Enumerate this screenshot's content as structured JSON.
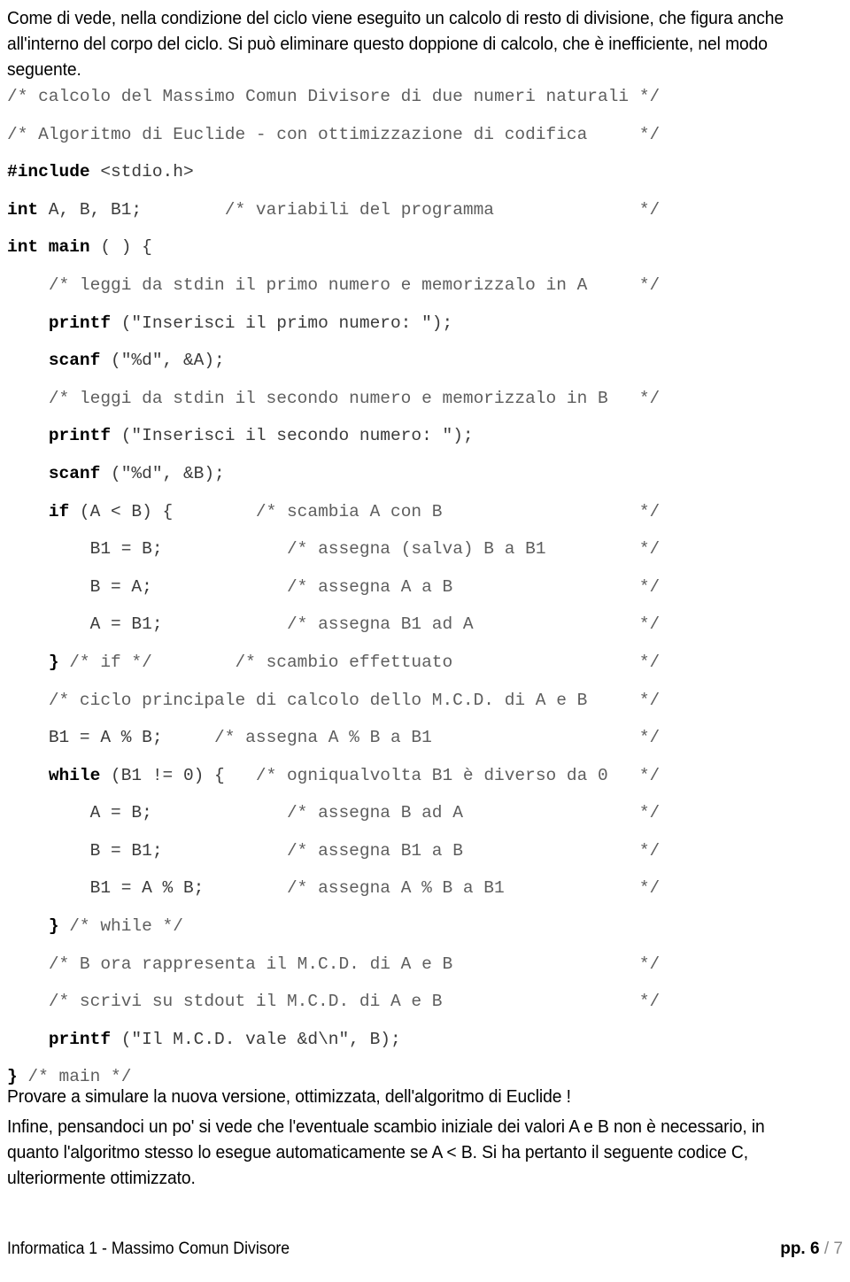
{
  "document": {
    "title": "Informatica 1 - Massimo Comun Divisore",
    "intro_paragraph": "Come di vede, nella condizione del ciclo viene eseguito un calcolo di resto di divisione, che figura anche all'interno del corpo del ciclo. Si può eliminare questo doppione di calcolo, che è inefficiente, nel modo seguente.",
    "closing_note": "Provare a simulare la nuova versione, ottimizzata, dell'algoritmo di Euclide !",
    "final_paragraph": "Infine, pensandoci un po' si vede che l'eventuale scambio iniziale dei valori A e B non è necessario, in quanto l'algoritmo stesso lo esegue automaticamente se A < B. Si ha pertanto il seguente codice C, ulteriormente ottimizzato."
  },
  "code": {
    "language": "C",
    "lines": [
      {
        "indent": 0,
        "segments": [
          {
            "t": "/* calcolo del Massimo Comun Divisore di due numeri naturali",
            "s": "cm"
          }
        ],
        "comment_end": "*/"
      },
      {
        "indent": 0,
        "segments": [
          {
            "t": "/* Algoritmo di Euclide - con ottimizzazione di codifica",
            "s": "cm"
          }
        ],
        "comment_end": "*/"
      },
      {
        "indent": 0,
        "segments": [
          {
            "t": "#include",
            "s": "kw"
          },
          {
            "t": " <stdio.h>",
            "s": "lit"
          }
        ],
        "comment_end": ""
      },
      {
        "indent": 0,
        "segments": [
          {
            "t": "int",
            "s": "kw"
          },
          {
            "t": " A, B, B1;",
            "s": "lit"
          },
          {
            "t": "        /* variabili del programma",
            "s": "cm"
          }
        ],
        "comment_end": "*/"
      },
      {
        "indent": 0,
        "segments": [
          {
            "t": "int main",
            "s": "kw"
          },
          {
            "t": " ( ) {",
            "s": "lit"
          }
        ],
        "comment_end": ""
      },
      {
        "indent": 1,
        "segments": [
          {
            "t": "/* leggi da stdin il primo numero e memorizzalo in A",
            "s": "cm"
          }
        ],
        "comment_end": "*/"
      },
      {
        "indent": 1,
        "segments": [
          {
            "t": "printf",
            "s": "kw"
          },
          {
            "t": " (\"Inserisci il primo numero: \");",
            "s": "lit"
          }
        ],
        "comment_end": ""
      },
      {
        "indent": 1,
        "segments": [
          {
            "t": "scanf",
            "s": "kw"
          },
          {
            "t": " (\"%d\", &A);",
            "s": "lit"
          }
        ],
        "comment_end": ""
      },
      {
        "indent": 1,
        "segments": [
          {
            "t": "/* leggi da stdin il secondo numero e memorizzalo in B",
            "s": "cm"
          }
        ],
        "comment_end": "*/"
      },
      {
        "indent": 1,
        "segments": [
          {
            "t": "printf",
            "s": "kw"
          },
          {
            "t": " (\"Inserisci il secondo numero: \");",
            "s": "lit"
          }
        ],
        "comment_end": ""
      },
      {
        "indent": 1,
        "segments": [
          {
            "t": "scanf",
            "s": "kw"
          },
          {
            "t": " (\"%d\", &B);",
            "s": "lit"
          }
        ],
        "comment_end": ""
      },
      {
        "indent": 1,
        "segments": [
          {
            "t": "if",
            "s": "kw"
          },
          {
            "t": " (A < B) {",
            "s": "lit"
          },
          {
            "t": "        /* scambia A con B",
            "s": "cm"
          }
        ],
        "comment_end": "*/"
      },
      {
        "indent": 2,
        "segments": [
          {
            "t": "B1 = B;",
            "s": "lit"
          },
          {
            "t": "            /* assegna (salva) B a B1",
            "s": "cm"
          }
        ],
        "comment_end": "*/"
      },
      {
        "indent": 2,
        "segments": [
          {
            "t": "B = A;",
            "s": "lit"
          },
          {
            "t": "             /* assegna A a B",
            "s": "cm"
          }
        ],
        "comment_end": "*/"
      },
      {
        "indent": 2,
        "segments": [
          {
            "t": "A = B1;",
            "s": "lit"
          },
          {
            "t": "            /* assegna B1 ad A",
            "s": "cm"
          }
        ],
        "comment_end": "*/"
      },
      {
        "indent": 1,
        "segments": [
          {
            "t": "}",
            "s": "kw"
          },
          {
            "t": " /* if */",
            "s": "cm"
          },
          {
            "t": "        /* scambio effettuato",
            "s": "cm"
          }
        ],
        "comment_end": "*/"
      },
      {
        "indent": 1,
        "segments": [
          {
            "t": "/* ciclo principale di calcolo dello M.C.D. di A e B",
            "s": "cm"
          }
        ],
        "comment_end": "*/"
      },
      {
        "indent": 1,
        "segments": [
          {
            "t": "B1 = A % B;",
            "s": "lit"
          },
          {
            "t": "     /* assegna A % B a B1",
            "s": "cm"
          }
        ],
        "comment_end": "*/"
      },
      {
        "indent": 1,
        "segments": [
          {
            "t": "while",
            "s": "kw"
          },
          {
            "t": " (B1 != 0) {",
            "s": "lit"
          },
          {
            "t": "   /* ogniqualvolta B1 è diverso da 0",
            "s": "cm"
          }
        ],
        "comment_end": "*/"
      },
      {
        "indent": 2,
        "segments": [
          {
            "t": "A = B;",
            "s": "lit"
          },
          {
            "t": "             /* assegna B ad A",
            "s": "cm"
          }
        ],
        "comment_end": "*/"
      },
      {
        "indent": 2,
        "segments": [
          {
            "t": "B = B1;",
            "s": "lit"
          },
          {
            "t": "            /* assegna B1 a B",
            "s": "cm"
          }
        ],
        "comment_end": "*/"
      },
      {
        "indent": 2,
        "segments": [
          {
            "t": "B1 = A % B;",
            "s": "lit"
          },
          {
            "t": "        /* assegna A % B a B1",
            "s": "cm"
          }
        ],
        "comment_end": "*/"
      },
      {
        "indent": 1,
        "segments": [
          {
            "t": "}",
            "s": "kw"
          },
          {
            "t": " /* while */",
            "s": "cm"
          }
        ],
        "comment_end": ""
      },
      {
        "indent": 1,
        "segments": [
          {
            "t": "/* B ora rappresenta il M.C.D. di A e B",
            "s": "cm"
          }
        ],
        "comment_end": "*/"
      },
      {
        "indent": 1,
        "segments": [
          {
            "t": "/* scrivi su stdout il M.C.D. di A e B",
            "s": "cm"
          }
        ],
        "comment_end": "*/"
      },
      {
        "indent": 1,
        "segments": [
          {
            "t": "printf",
            "s": "kw"
          },
          {
            "t": " (\"Il M.C.D. vale &d\\n\", B);",
            "s": "lit"
          }
        ],
        "comment_end": ""
      },
      {
        "indent": 0,
        "segments": [
          {
            "t": "}",
            "s": "kw"
          },
          {
            "t": " /* main */",
            "s": "cm"
          }
        ],
        "comment_end": ""
      }
    ]
  },
  "footer": {
    "left_text": "Informatica 1 - Massimo Comun Divisore",
    "page_prefix": "pp.",
    "page_current": "6",
    "page_separator": "/",
    "page_total": "7"
  }
}
